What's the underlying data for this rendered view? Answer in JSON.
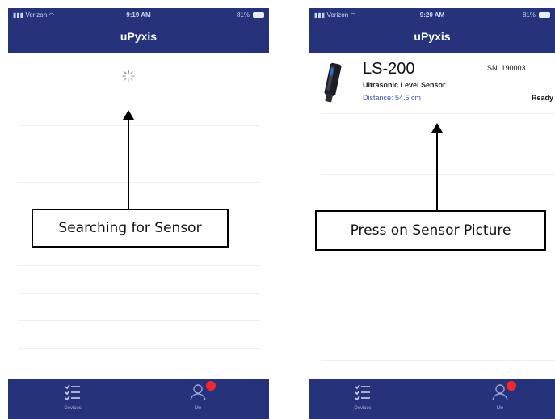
{
  "left_screen": {
    "status": {
      "carrier": "Verizon",
      "time": "9:19 AM",
      "battery": "81%"
    },
    "title": "uPyxis",
    "callout": "Searching for Sensor",
    "tabs": {
      "devices": "Devices",
      "me": "Me"
    }
  },
  "right_screen": {
    "status": {
      "carrier": "Verizon",
      "time": "9:20 AM",
      "battery": "81%"
    },
    "title": "uPyxis",
    "sensor": {
      "model": "LS-200",
      "description": "Ultrasonic Level Sensor",
      "distance": "Distance: 54.5 cm",
      "serial": "SN: 190003",
      "status": "Ready"
    },
    "callout": "Press on Sensor Picture",
    "tabs": {
      "devices": "Devices",
      "me": "Me"
    }
  },
  "colors": {
    "nav": "#26337a",
    "accent_text": "#3a55b0",
    "badge": "#f0292c"
  },
  "icons": [
    "wifi-icon",
    "signal-icon",
    "battery-icon",
    "loading-spinner-icon",
    "devices-list-icon",
    "person-icon"
  ]
}
